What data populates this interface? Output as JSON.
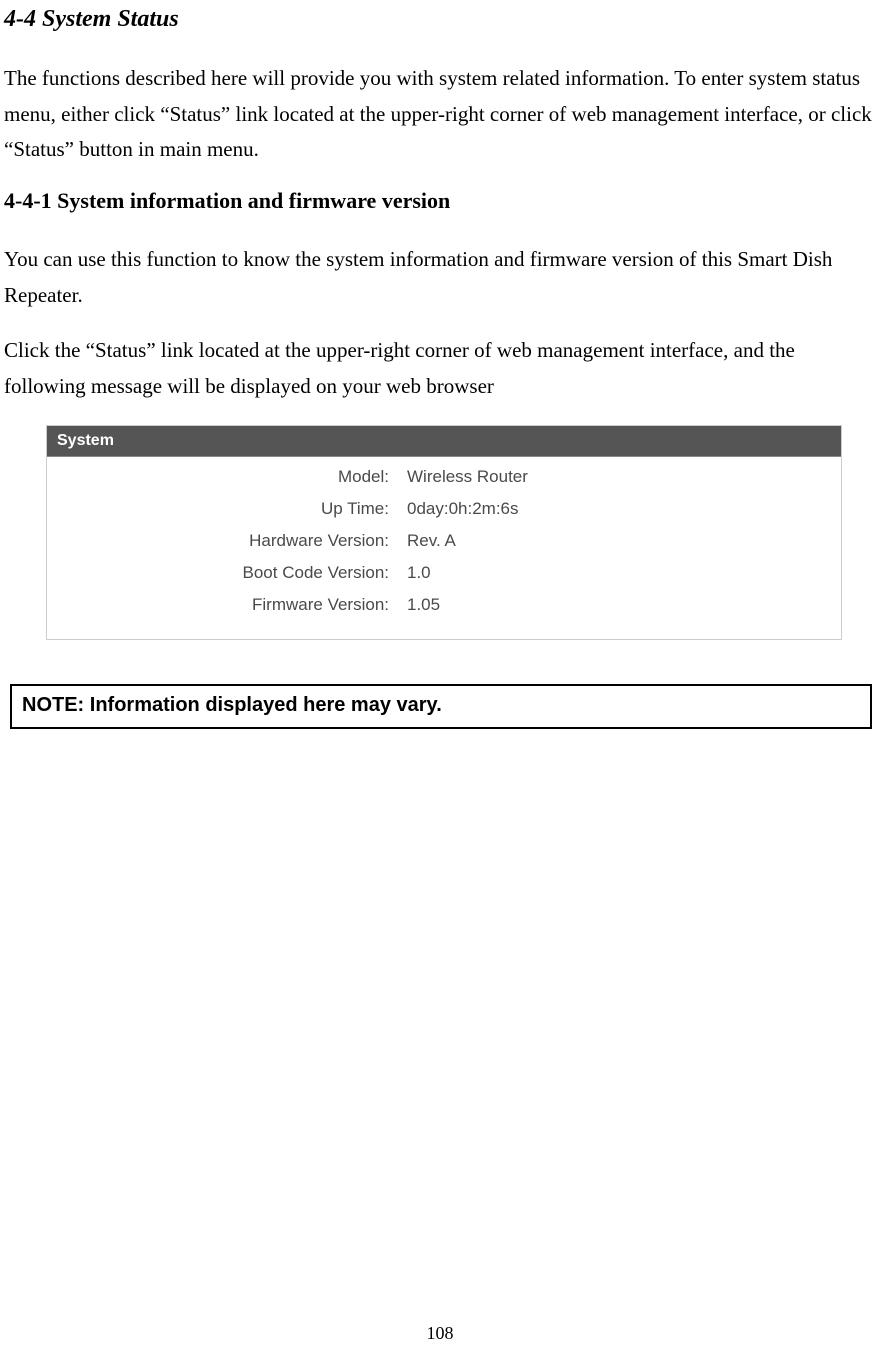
{
  "section_title": "4-4 System Status",
  "para1": "The functions described here will provide you with system related information. To enter system status menu, either click “Status” link located at the upper-right corner of web management interface, or click “Status” button in main menu.",
  "subsection_title": "4-4-1 System information and firmware version",
  "para2": "You can use this function to know the system information and firmware version of this Smart Dish Repeater.",
  "para3": "Click the “Status” link located at the upper-right corner of web management interface, and the following message will be displayed on your web browser",
  "screenshot": {
    "header": "System",
    "rows": [
      {
        "label": "Model:",
        "value": "Wireless Router"
      },
      {
        "label": "Up Time:",
        "value": "0day:0h:2m:6s"
      },
      {
        "label": "Hardware Version:",
        "value": "Rev. A"
      },
      {
        "label": "Boot Code Version:",
        "value": "1.0"
      },
      {
        "label": "Firmware Version:",
        "value": "1.05"
      }
    ]
  },
  "note": "NOTE: Information displayed here may vary.",
  "page_number": "108"
}
